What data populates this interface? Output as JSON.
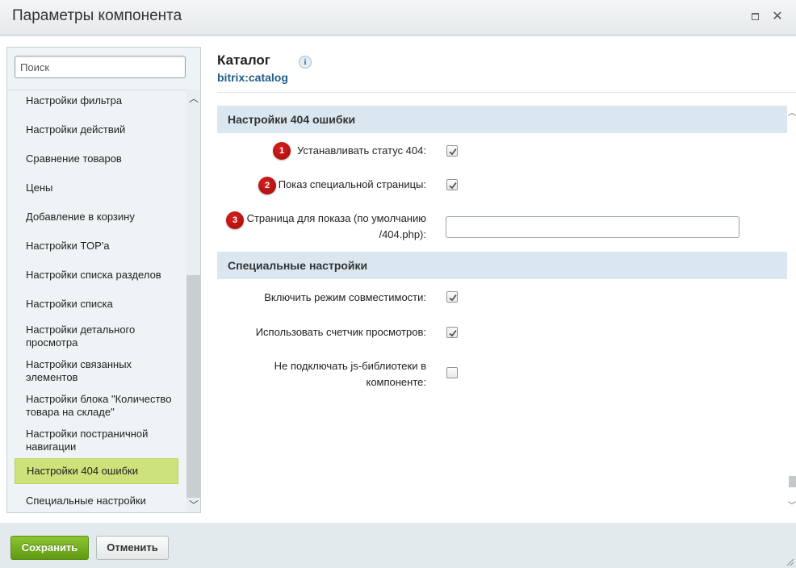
{
  "window": {
    "title": "Параметры компонента"
  },
  "search": {
    "placeholder": "Поиск"
  },
  "sidebar": {
    "items": [
      {
        "label": "Настройки фильтра"
      },
      {
        "label": "Настройки действий"
      },
      {
        "label": "Сравнение товаров"
      },
      {
        "label": "Цены"
      },
      {
        "label": "Добавление в корзину"
      },
      {
        "label": "Настройки TOP'а"
      },
      {
        "label": "Настройки списка разделов"
      },
      {
        "label": "Настройки списка"
      },
      {
        "label": "Настройки детального просмотра"
      },
      {
        "label": "Настройки связанных элементов"
      },
      {
        "label": "Настройки блока \"Количество товара на складе\""
      },
      {
        "label": "Настройки постраничной навигации"
      },
      {
        "label": "Настройки 404 ошибки"
      },
      {
        "label": "Специальные настройки"
      }
    ],
    "active_item": "Настройки 404 ошибки"
  },
  "component": {
    "title": "Каталог",
    "info_glyph": "i",
    "code": "bitrix:catalog"
  },
  "sections": [
    {
      "header": "Настройки 404 ошибки",
      "fields": [
        {
          "badge": "1",
          "label": "Устанавливать статус 404:",
          "type": "checkbox",
          "checked": true
        },
        {
          "badge": "2",
          "label": "Показ специальной страницы:",
          "type": "checkbox",
          "checked": true
        },
        {
          "badge": "3",
          "label_line1": "Страница для показа (по умолчанию",
          "label_line2": "/404.php):",
          "type": "text",
          "value": ""
        }
      ]
    },
    {
      "header": "Специальные настройки",
      "fields": [
        {
          "label": "Включить режим совместимости:",
          "type": "checkbox",
          "checked": true
        },
        {
          "label": "Использовать счетчик просмотров:",
          "type": "checkbox",
          "checked": true
        },
        {
          "label_line1": "Не подключать js-библиотеки в",
          "label_line2": "компоненте:",
          "type": "checkbox",
          "checked": false
        }
      ]
    }
  ],
  "footer": {
    "save_label": "Сохранить",
    "cancel_label": "Отменить"
  },
  "colors": {
    "save_button": "#6aa81c",
    "active_item": "#cde27a",
    "section_header": "#dbe7f0",
    "badge": "#b00f0f",
    "code_link": "#1f5d86"
  }
}
